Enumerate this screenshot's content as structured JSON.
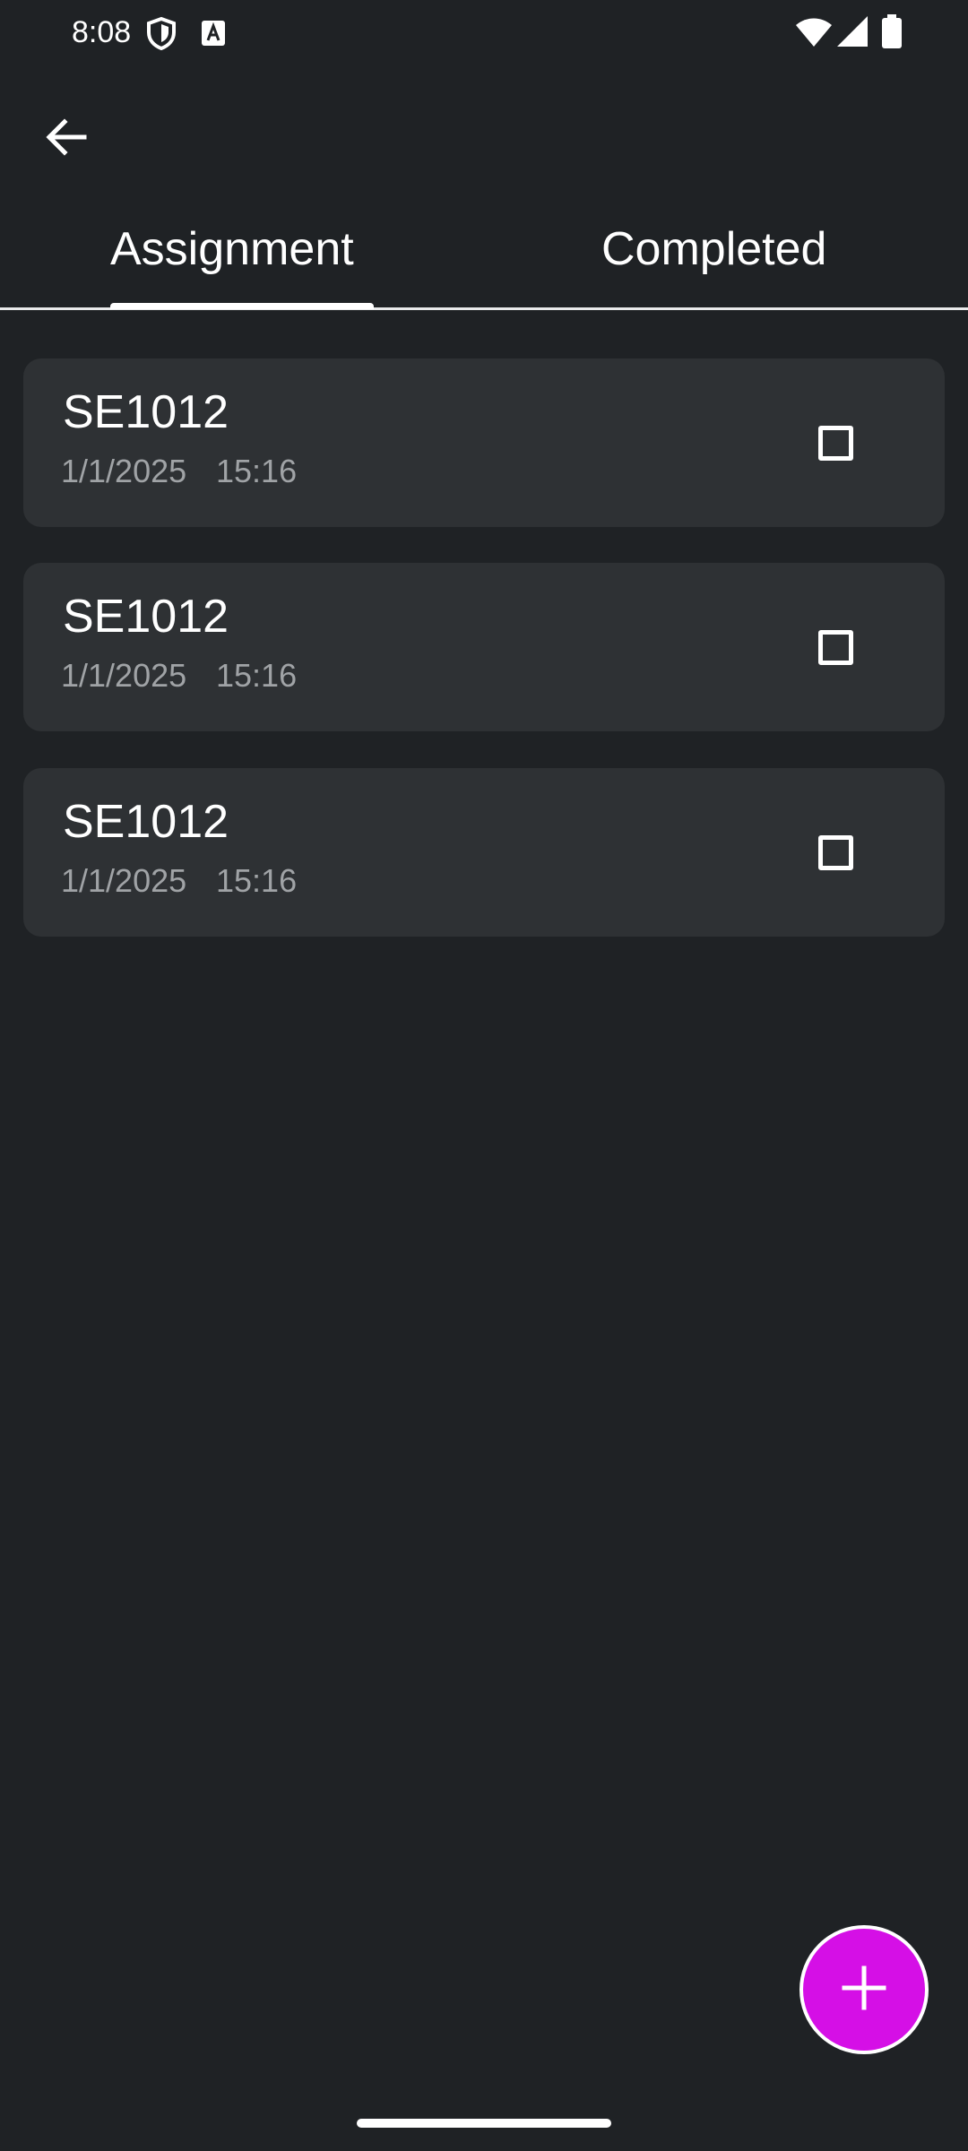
{
  "status_bar": {
    "time": "8:08",
    "icons": [
      "shield-icon",
      "font-a-icon",
      "wifi-icon",
      "signal-icon",
      "battery-icon"
    ]
  },
  "app_bar": {
    "back_icon": "arrow-left-icon"
  },
  "tabs": [
    {
      "label": "Assignment",
      "selected": true
    },
    {
      "label": "Completed",
      "selected": false
    }
  ],
  "assignments": [
    {
      "title": "SE1012",
      "date": "1/1/2025",
      "time": "15:16",
      "checked": false
    },
    {
      "title": "SE1012",
      "date": "1/1/2025",
      "time": "15:16",
      "checked": false
    },
    {
      "title": "SE1012",
      "date": "1/1/2025",
      "time": "15:16",
      "checked": false
    }
  ],
  "fab": {
    "icon": "plus-icon"
  },
  "colors": {
    "background": "#1f2225",
    "card": "#2e3134",
    "accent": "#d50fe6",
    "secondary_text": "#a0a3a6"
  }
}
